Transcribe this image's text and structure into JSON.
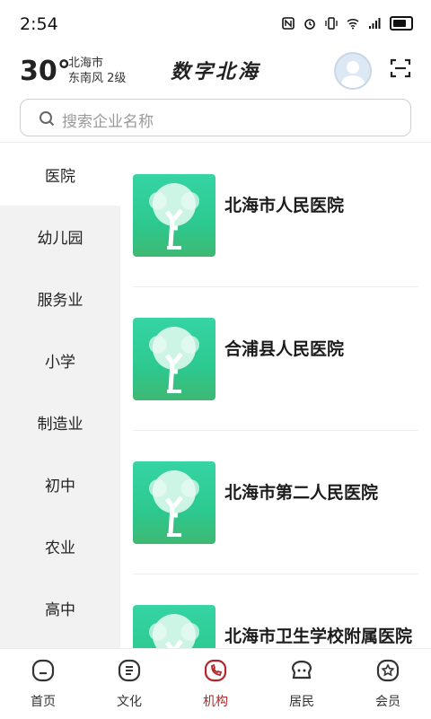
{
  "status_bar": {
    "time": "2:54"
  },
  "header": {
    "temperature": "30°",
    "city": "北海市",
    "wind": "东南风  2级",
    "brand": "数字北海"
  },
  "search": {
    "placeholder": "搜索企业名称"
  },
  "categories": [
    "医院",
    "幼儿园",
    "服务业",
    "小学",
    "制造业",
    "初中",
    "农业",
    "高中"
  ],
  "active_category": "医院",
  "organizations": [
    {
      "name": "北海市人民医院"
    },
    {
      "name": "合浦县人民医院"
    },
    {
      "name": "北海市第二人民医院"
    },
    {
      "name": "北海市卫生学校附属医院"
    }
  ],
  "tabs": [
    {
      "label": "首页",
      "icon": "home-icon"
    },
    {
      "label": "文化",
      "icon": "document-icon"
    },
    {
      "label": "机构",
      "icon": "phone-icon"
    },
    {
      "label": "居民",
      "icon": "resident-icon"
    },
    {
      "label": "会员",
      "icon": "member-icon"
    }
  ],
  "colors": {
    "accent": "#b3262a",
    "thumb_green": "#2cc98f",
    "sidebar_bg": "#f2f2f2"
  }
}
